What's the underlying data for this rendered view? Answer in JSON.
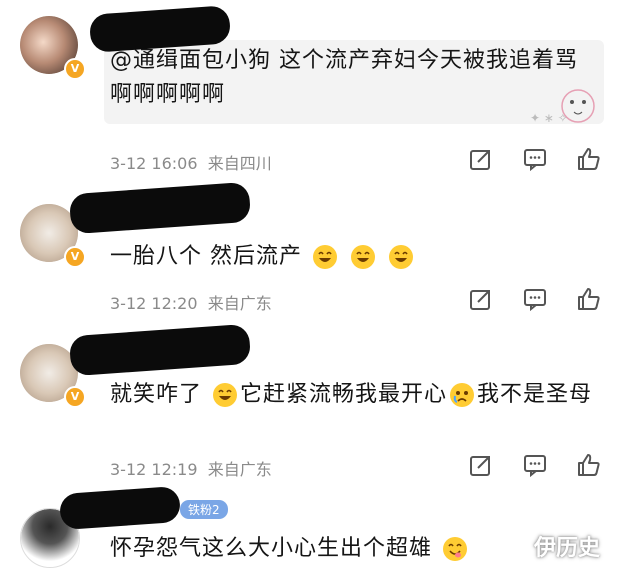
{
  "comments": [
    {
      "mention": "@通缉面包小狗",
      "text": " 这个流产弃妇今天被我追着骂啊啊啊啊啊",
      "date": "3-12 16:06",
      "location": "来自四川"
    },
    {
      "text": "一胎八个 然后流产",
      "date": "3-12 12:20",
      "location": "来自广东"
    },
    {
      "text_parts": [
        "就笑咋了",
        "它赶紧流畅我最开心",
        "我不是圣母"
      ],
      "date": "3-12 12:19",
      "location": "来自广东"
    },
    {
      "badge": "铁粉2",
      "text": "怀孕怨气这么大小心生出个超雄"
    }
  ],
  "icons": {
    "repost": "repost-icon",
    "comment": "comment-icon",
    "like": "like-icon"
  },
  "watermark": "伊历史",
  "colors": {
    "badge_orange": "#f5a623",
    "fan_badge": "#7aa6e6",
    "meta_gray": "#8a8a8a"
  }
}
